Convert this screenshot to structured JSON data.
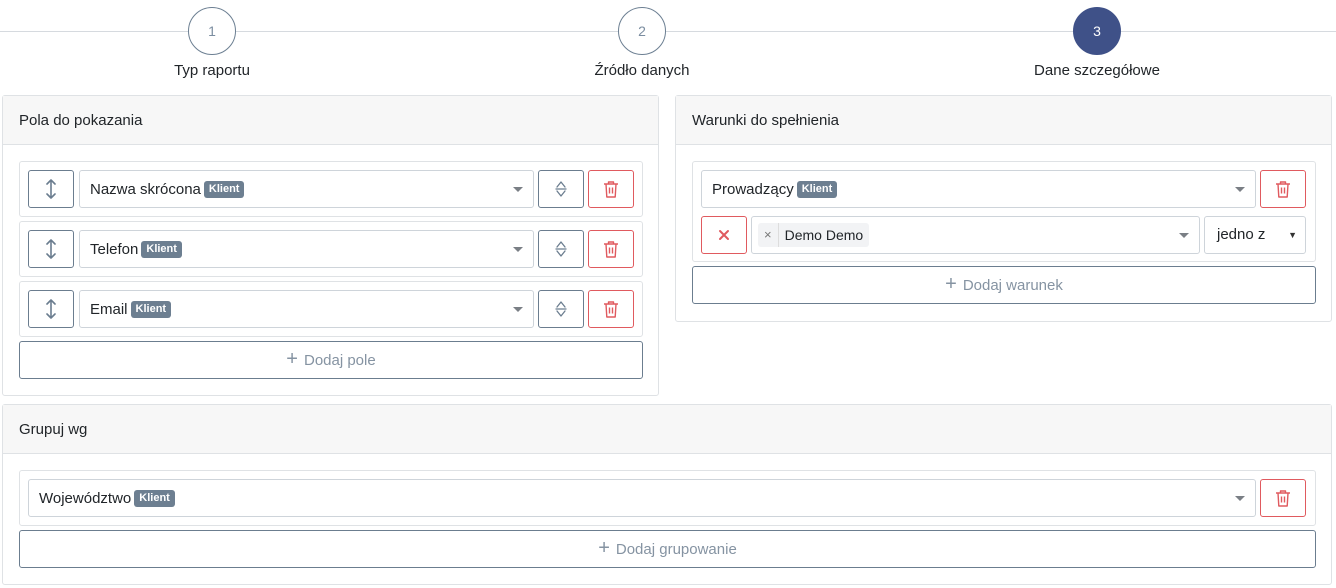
{
  "stepper": {
    "steps": [
      {
        "number": "1",
        "label": "Typ raportu"
      },
      {
        "number": "2",
        "label": "Źródło danych"
      },
      {
        "number": "3",
        "label": "Dane szczegółowe"
      }
    ],
    "active_step": 3
  },
  "fields_panel": {
    "title": "Pola do pokazania",
    "rows": [
      {
        "value": "Nazwa skrócona",
        "badge": "Klient"
      },
      {
        "value": "Telefon",
        "badge": "Klient"
      },
      {
        "value": "Email",
        "badge": "Klient"
      }
    ],
    "add_label": "Dodaj pole"
  },
  "conditions_panel": {
    "title": "Warunki do spełnienia",
    "condition": {
      "field": "Prowadzący",
      "badge": "Klient",
      "tag_remove": "×",
      "tag_value": "Demo Demo",
      "operator": "jedno z"
    },
    "add_label": "Dodaj warunek"
  },
  "group_panel": {
    "title": "Grupuj wg",
    "row": {
      "value": "Województwo",
      "badge": "Klient"
    },
    "add_label": "Dodaj grupowanie"
  },
  "colors": {
    "accent": "#3f5188",
    "secondary": "#6b7d8f",
    "danger": "#e05a5f",
    "badge": "#6d7f91"
  },
  "icons": {
    "move": "vertical-arrows-icon",
    "sort": "sort-icon",
    "delete": "trash-icon",
    "clear": "close-icon",
    "add": "plus-icon"
  }
}
